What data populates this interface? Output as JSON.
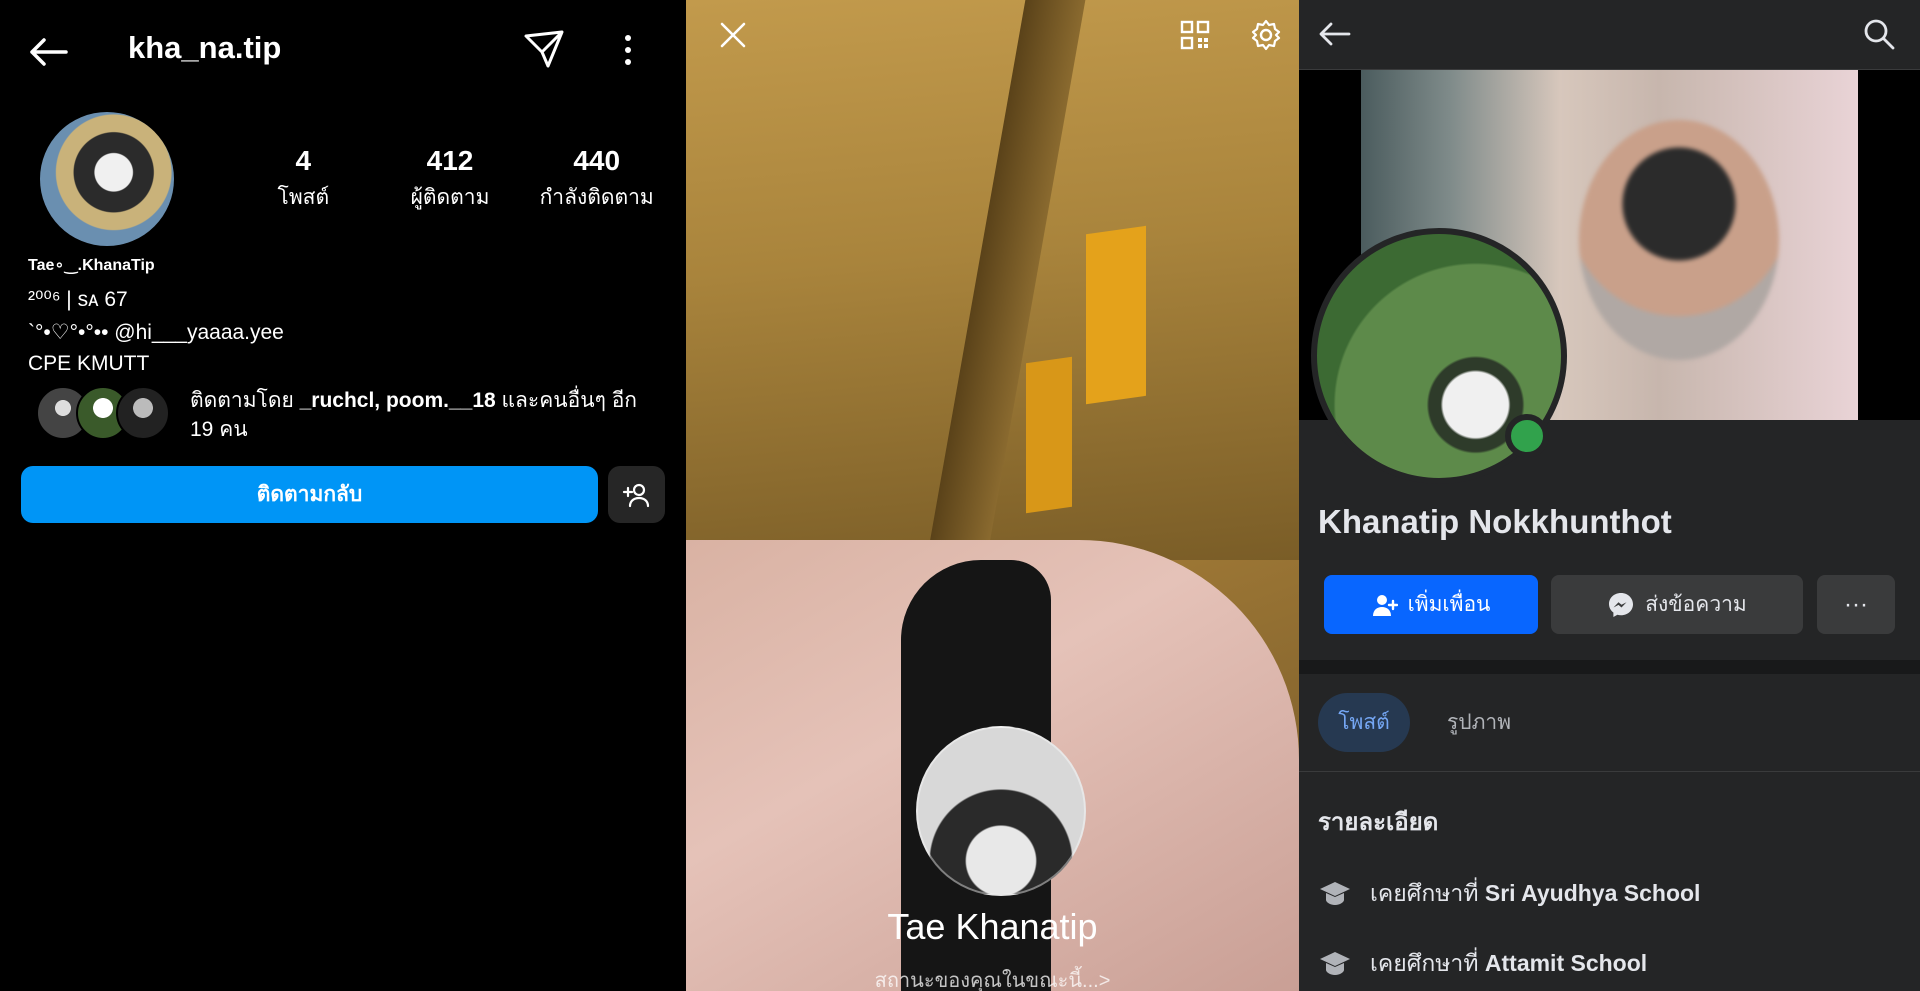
{
  "instagram": {
    "username": "kha_na.tip",
    "stats": [
      {
        "value": "4",
        "label": "โพสต์"
      },
      {
        "value": "412",
        "label": "ผู้ติดตาม"
      },
      {
        "value": "440",
        "label": "กำลังติดตาม"
      }
    ],
    "display_name": "Tae∘‿.KhanaTip",
    "bio_line1": "²⁰⁰⁶ | sᴀ 67",
    "bio_line2": "`°•♡°•°•• @hi___yaaaa.yee",
    "bio_line3": "CPE KMUTT",
    "followed_by_prefix": "ติดตามโดย ",
    "followed_by_names": "_ruchcl, poom.__18",
    "followed_by_suffix": " และคนอื่นๆ อีก 19 คน",
    "follow_back_label": "ติดตามกลับ",
    "icons": {
      "back": "arrow-left",
      "dm": "paper-plane",
      "more": "vertical-dots",
      "add_user": "person-plus"
    },
    "colors": {
      "follow_button": "#0095f6"
    }
  },
  "story": {
    "name": "Tae Khanatip",
    "status": "สถานะของคุณในขณะนี้...>",
    "icons": {
      "close": "x",
      "qr": "qr-code",
      "settings": "gear"
    }
  },
  "facebook": {
    "name": "Khanatip Nokkhunthot",
    "add_friend_label": "เพิ่มเพื่อน",
    "message_label": "ส่งข้อความ",
    "more_label": "···",
    "tabs": [
      {
        "label": "โพสต์",
        "active": true
      },
      {
        "label": "รูปภาพ",
        "active": false
      }
    ],
    "details_title": "รายละเอียด",
    "education": [
      {
        "prefix": "เคยศึกษาที่ ",
        "school": "Sri Ayudhya School"
      },
      {
        "prefix": "เคยศึกษาที่ ",
        "school": "Attamit School"
      }
    ],
    "icons": {
      "back": "arrow-left",
      "search": "magnifier",
      "education": "graduation-cap",
      "online": "green-dot"
    },
    "colors": {
      "add_friend": "#0866ff",
      "online": "#31a24c"
    }
  }
}
